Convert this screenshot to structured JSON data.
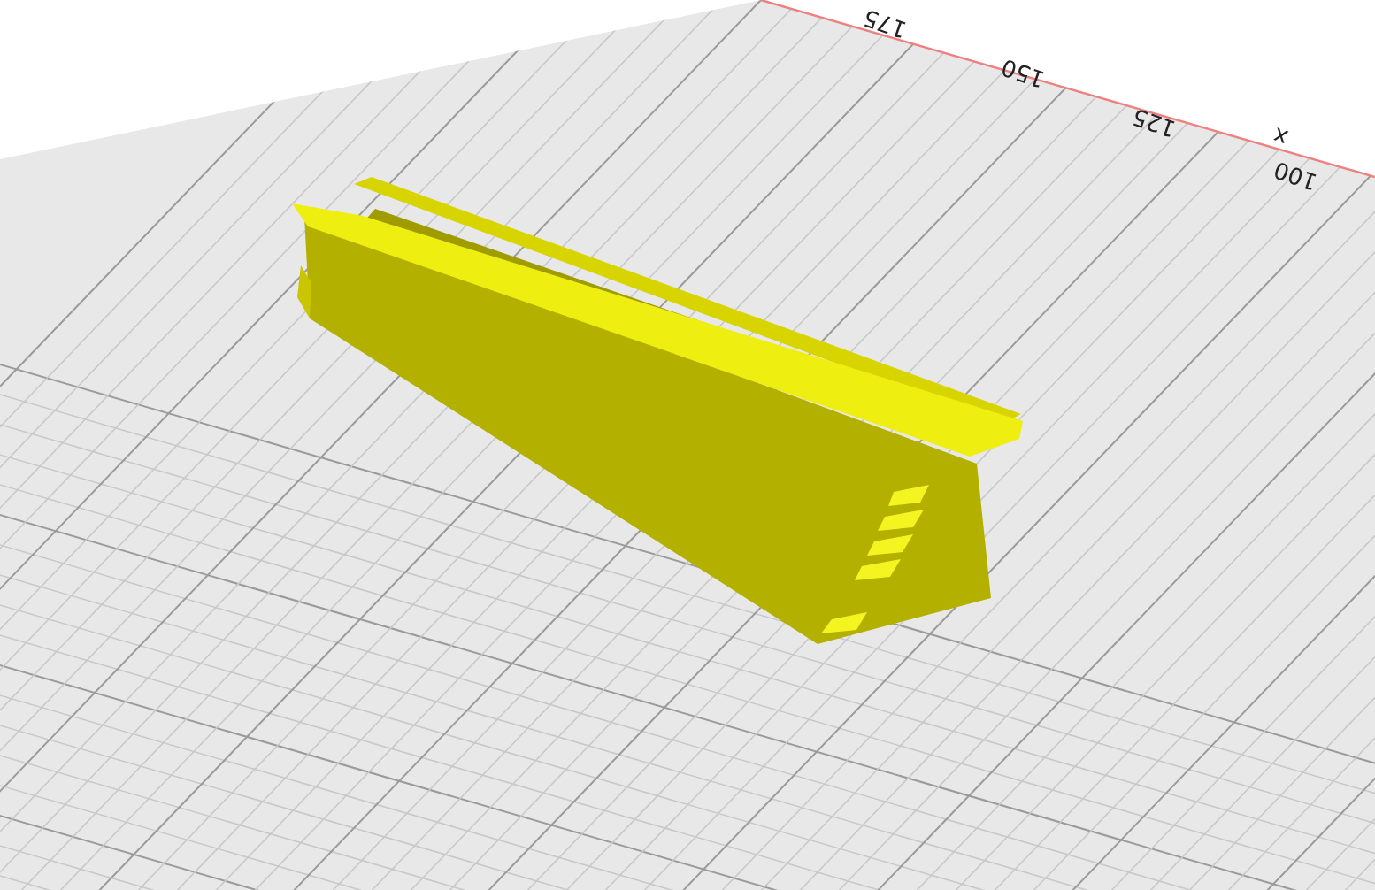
{
  "viewport": {
    "axis_labels": [
      {
        "text": "175"
      },
      {
        "text": "150"
      },
      {
        "text": "125"
      },
      {
        "text": "100"
      }
    ],
    "axis_name": "x"
  }
}
